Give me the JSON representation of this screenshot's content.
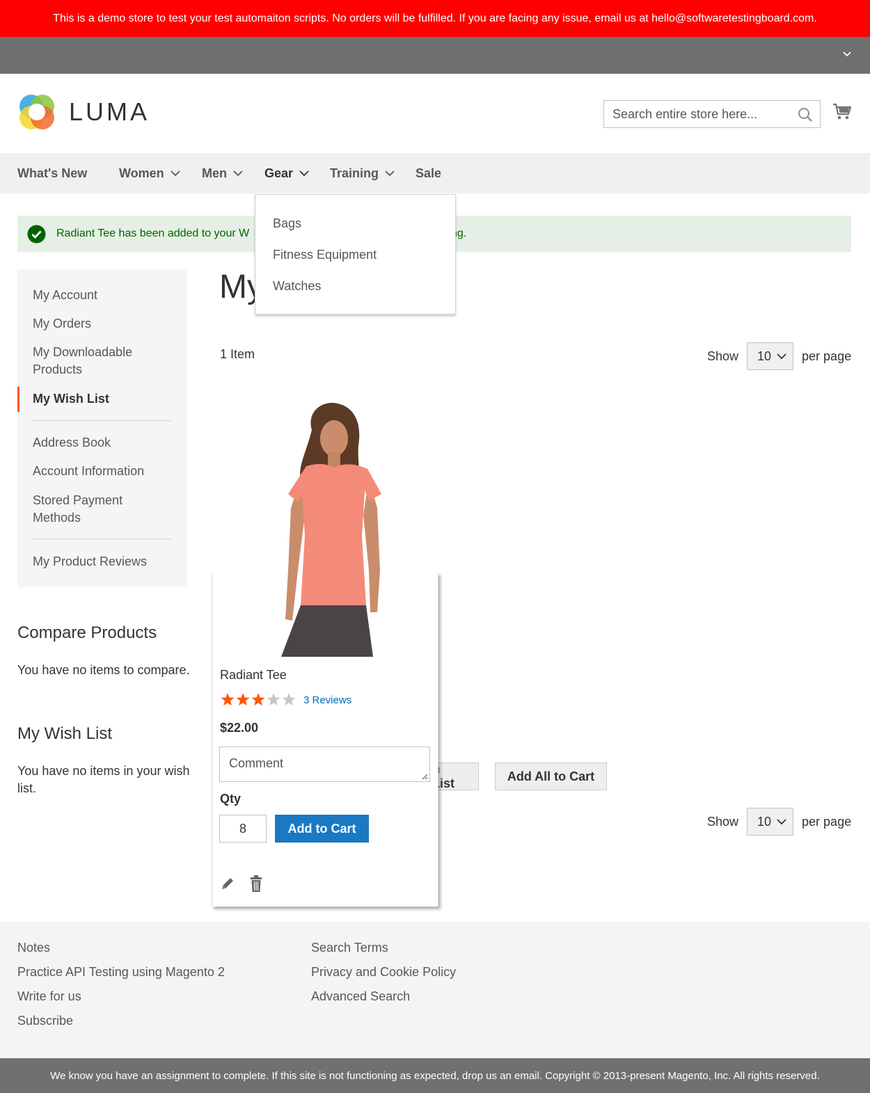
{
  "demo_notice": "This is a demo store to test your test automaiton scripts. No orders will be fulfilled. If you are facing any issue, email us at hello@softwaretestingboard.com.",
  "header": {
    "logo_text": "LUMA",
    "search_placeholder": "Search entire store here..."
  },
  "nav": {
    "items": [
      {
        "label": "What's New",
        "has_submenu": false
      },
      {
        "label": "Women",
        "has_submenu": true
      },
      {
        "label": "Men",
        "has_submenu": true
      },
      {
        "label": "Gear",
        "has_submenu": true
      },
      {
        "label": "Training",
        "has_submenu": true
      },
      {
        "label": "Sale",
        "has_submenu": false
      }
    ],
    "gear_submenu": [
      "Bags",
      "Fitness Equipment",
      "Watches"
    ]
  },
  "message": {
    "visible_start": "Radiant Tee has been added to your W",
    "visible_end": "ng."
  },
  "account_nav": {
    "items": [
      "My Account",
      "My Orders",
      "My Downloadable Products",
      "My Wish List",
      "Address Book",
      "Account Information",
      "Stored Payment Methods",
      "My Product Reviews"
    ],
    "current": "My Wish List"
  },
  "compare": {
    "title": "Compare Products",
    "empty": "You have no items to compare."
  },
  "wishlist_block": {
    "title": "My Wish List",
    "empty": "You have no items in your wish list."
  },
  "page": {
    "title_visible": "My",
    "item_count": "1 Item",
    "show_label": "Show",
    "limit_value": "10",
    "per_page_label": "per page",
    "partial_button_label": "n List",
    "add_all_label": "Add All to Cart"
  },
  "product": {
    "name": "Radiant Tee",
    "rating_stars": 3,
    "rating_max": 5,
    "reviews_label": "3 Reviews",
    "price": "$22.00",
    "comment_placeholder": "Comment",
    "qty_label": "Qty",
    "qty_value": "8",
    "add_to_cart_label": "Add to Cart",
    "shirt_color": "#f48b78"
  },
  "footer": {
    "col1": [
      "Notes",
      "Practice API Testing using Magento 2",
      "Write for us",
      "Subscribe"
    ],
    "col2": [
      "Search Terms",
      "Privacy and Cookie Policy",
      "Advanced Search"
    ]
  },
  "copyright": "We know you have an assignment to complete. If this site is not functioning as expected, drop us an email. Copyright © 2013-present Magento, Inc. All rights reserved.",
  "colors": {
    "banner": "#ff0000",
    "accent_blue": "#1979c3",
    "success_bg": "#e5efe5",
    "success_text": "#006400",
    "star_active": "#ff5501",
    "star_inactive": "#c7c7c7"
  }
}
